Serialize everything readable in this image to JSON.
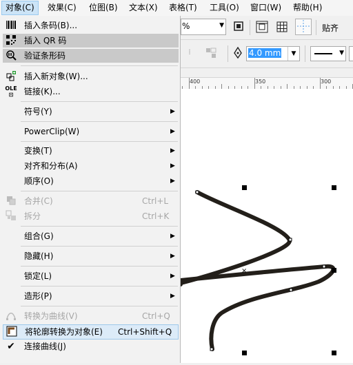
{
  "menubar": {
    "items": [
      {
        "label": "对象(C)",
        "active": true
      },
      {
        "label": "效果(C)"
      },
      {
        "label": "位图(B)"
      },
      {
        "label": "文本(X)"
      },
      {
        "label": "表格(T)"
      },
      {
        "label": "工具(O)"
      },
      {
        "label": "窗口(W)"
      },
      {
        "label": "帮助(H)"
      }
    ]
  },
  "toolbar": {
    "zoom_suffix": "%",
    "snap_label": "贴齐",
    "outline_width": "4.0 mm"
  },
  "ruler": {
    "labels": [
      "400",
      "350",
      "300"
    ]
  },
  "menu": {
    "items": [
      {
        "label": "插入条码(B)...",
        "icon": "barcode-icon"
      },
      {
        "label": "插入 QR 码",
        "icon": "qr-code-icon",
        "highlight": "gray"
      },
      {
        "label": "验证条形码",
        "icon": "validate-barcode-icon",
        "highlight": "gray"
      },
      {
        "label": "插入新对象(W)...",
        "icon": "insert-object-icon"
      },
      {
        "label": "链接(K)...",
        "icon": "ole-link-icon"
      },
      {
        "label": "符号(Y)",
        "submenu": true
      },
      {
        "label": "PowerClip(W)",
        "submenu": true
      },
      {
        "label": "变换(T)",
        "submenu": true
      },
      {
        "label": "对齐和分布(A)",
        "submenu": true
      },
      {
        "label": "顺序(O)",
        "submenu": true
      },
      {
        "label": "合并(C)",
        "shortcut": "Ctrl+L",
        "disabled": true,
        "icon": "combine-icon"
      },
      {
        "label": "拆分",
        "shortcut": "Ctrl+K",
        "disabled": true,
        "icon": "break-apart-icon"
      },
      {
        "label": "组合(G)",
        "submenu": true
      },
      {
        "label": "隐藏(H)",
        "submenu": true
      },
      {
        "label": "锁定(L)",
        "submenu": true
      },
      {
        "label": "造形(P)",
        "submenu": true
      },
      {
        "label": "转换为曲线(V)",
        "shortcut": "Ctrl+Q",
        "disabled": true,
        "icon": "convert-to-curves-icon"
      },
      {
        "label": "将轮廓转换为对象(E)",
        "shortcut": "Ctrl+Shift+Q",
        "highlight": "blue",
        "icon": "outline-to-object-icon"
      },
      {
        "label": "连接曲线(J)",
        "icon": "check-icon"
      }
    ]
  }
}
